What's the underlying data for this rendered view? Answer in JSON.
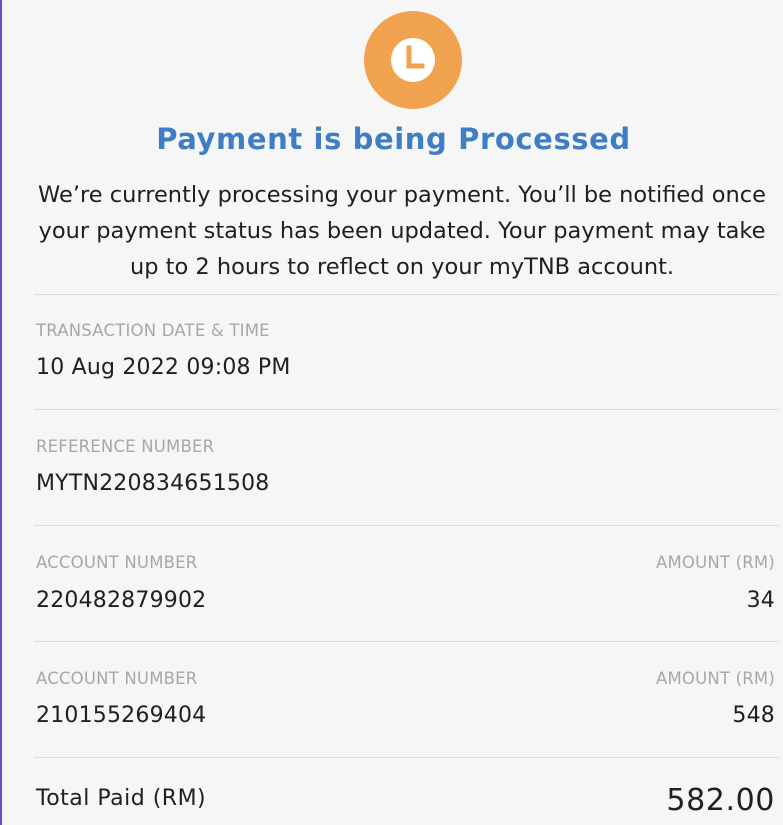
{
  "status": {
    "icon": "clock-icon",
    "icon_color": "#f0a24f",
    "title": "Payment is being Processed",
    "title_color": "#3f7ec7",
    "message": "We’re currently processing your payment. You’ll be notified once your payment status has been updated. Your payment may take up to 2 hours to reflect on your myTNB account."
  },
  "transaction": {
    "date_label": "TRANSACTION DATE & TIME",
    "date_value": "10 Aug 2022 09:08 PM",
    "reference_label": "REFERENCE NUMBER",
    "reference_value": "MYTN220834651508"
  },
  "accounts": [
    {
      "account_label": "ACCOUNT NUMBER",
      "account_number": "220482879902",
      "amount_label": "AMOUNT (RM)",
      "amount": "34"
    },
    {
      "account_label": "ACCOUNT NUMBER",
      "account_number": "210155269404",
      "amount_label": "AMOUNT (RM)",
      "amount": "548"
    }
  ],
  "total": {
    "label": "Total Paid  (RM)",
    "value": "582.00"
  }
}
